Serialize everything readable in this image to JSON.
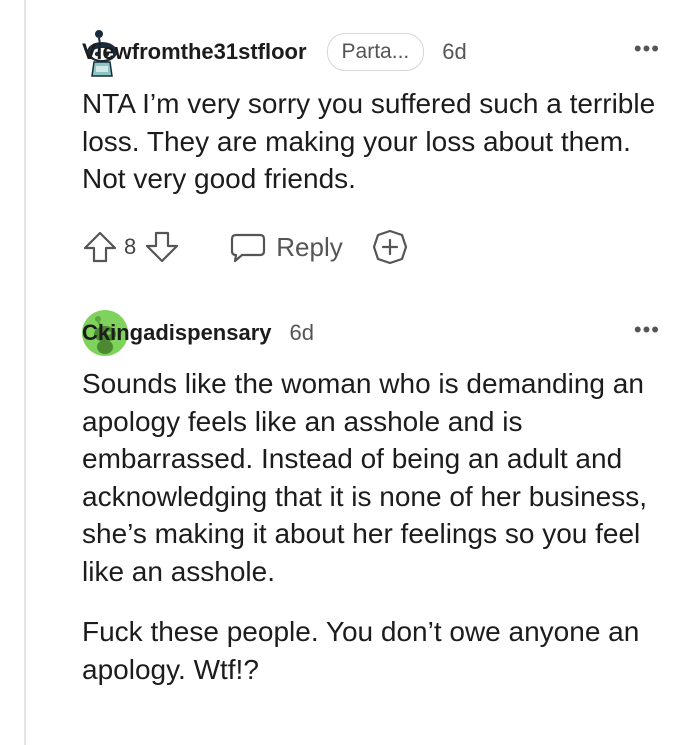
{
  "comments": [
    {
      "username": "Viewfromthe31stfloor",
      "flair": "Parta...",
      "timestamp": "6d",
      "more": "•••",
      "paragraphs": [
        "NTA I’m very sorry you suffered such a terrible loss. They are making your loss about them. Not very good friends."
      ],
      "score": "8",
      "reply_label": "Reply"
    },
    {
      "username": "Ckingadispensary",
      "timestamp": "6d",
      "more": "•••",
      "paragraphs": [
        "Sounds like the woman who is demanding an apology feels like an asshole and is embarrassed. Instead of being an adult and acknowledging that it is none of her business, she’s making it about her feelings so you feel like an asshole.",
        "Fuck these people. You don’t owe anyone an apology. Wtf!?"
      ]
    }
  ],
  "colors": {
    "avatar_green": "#7fd35c",
    "snoo_dark": "#1a2b3a",
    "thread_line": "#e6e6e6"
  }
}
